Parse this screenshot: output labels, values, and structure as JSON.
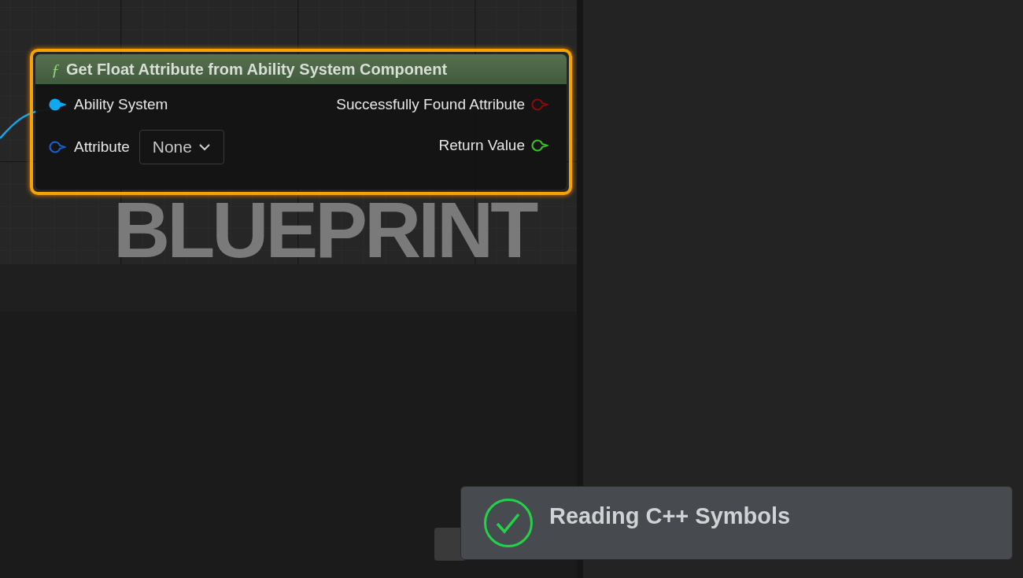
{
  "graph": {
    "watermark": "BLUEPRINT",
    "node": {
      "icon": "ƒ",
      "title": "Get Float Attribute from Ability System Component",
      "selected": true,
      "inputs": [
        {
          "label": "Ability System",
          "connected": true,
          "color": "#10a8f0"
        },
        {
          "label": "Attribute",
          "connected": false,
          "color": "#1a5fd0",
          "dropdown": "None"
        }
      ],
      "outputs": [
        {
          "label": "Successfully Found Attribute",
          "connected": false,
          "color": "#8a0b0b"
        },
        {
          "label": "Return Value",
          "connected": false,
          "color": "#3cc02a"
        }
      ]
    }
  },
  "notification": {
    "text": "Reading C++ Symbols",
    "succeeded": true
  }
}
